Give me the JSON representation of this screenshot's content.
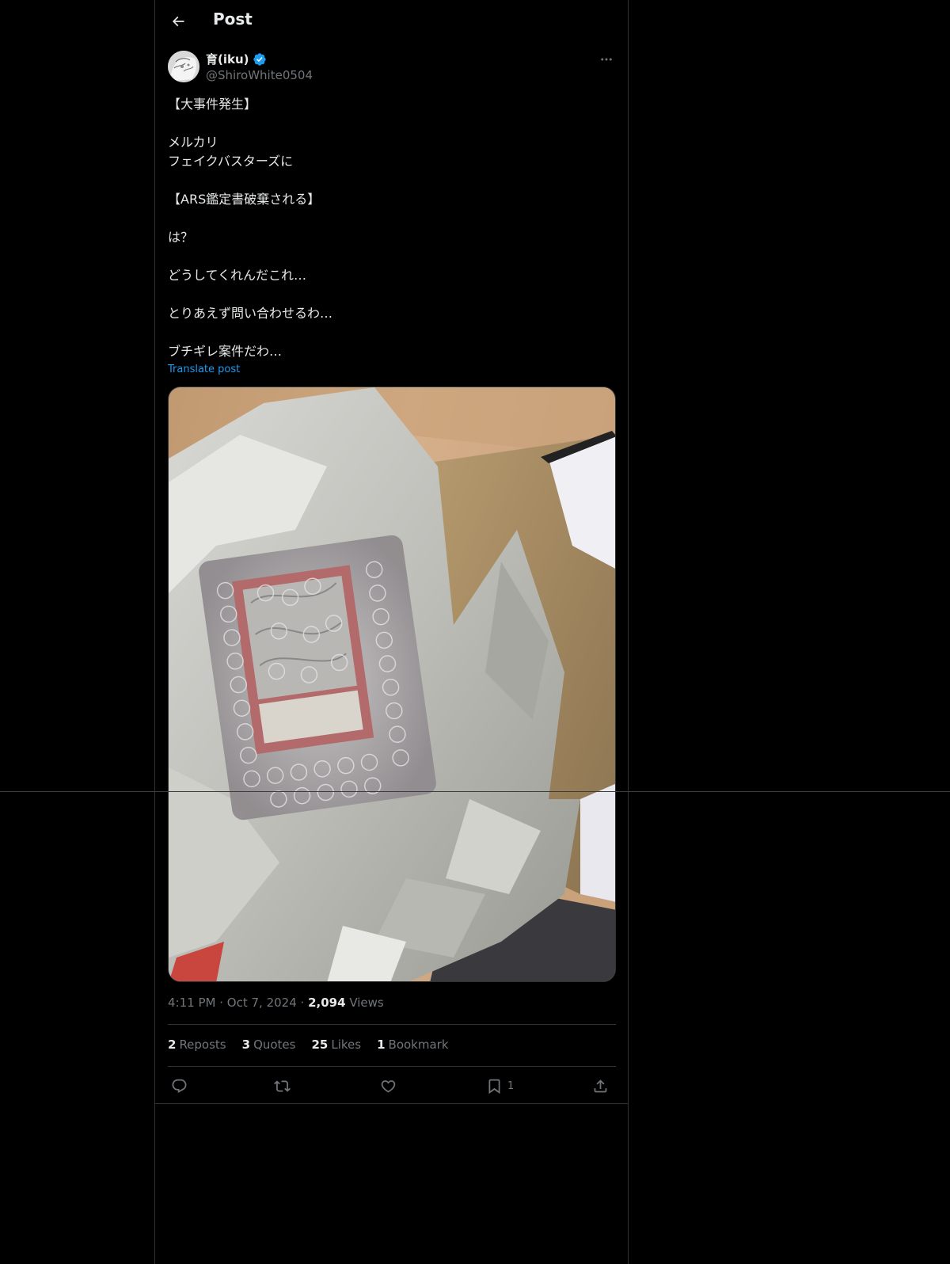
{
  "header": {
    "title": "Post",
    "back_icon": "arrow-left-icon"
  },
  "author": {
    "display_name": "育(iku)",
    "handle": "@ShiroWhite0504",
    "verified": true,
    "verified_color": "#1d9bf0"
  },
  "post": {
    "lines": [
      "【大事件発生】",
      "",
      "メルカリ",
      "フェイクバスターズに",
      "",
      "【ARS鑑定書破棄される】",
      "",
      "は？",
      "",
      "どうしてくれんだこれ…",
      "",
      "とりあえず問い合わせるわ…",
      "",
      "ブチギレ案件だわ…"
    ],
    "translate_label": "Translate post"
  },
  "meta": {
    "time": "4:11 PM",
    "date": "Oct 7, 2024",
    "views_count": "2,094",
    "views_label": "Views"
  },
  "stats": {
    "reposts_count": "2",
    "reposts_label": "Reposts",
    "quotes_count": "3",
    "quotes_label": "Quotes",
    "likes_count": "25",
    "likes_label": "Likes",
    "bookmarks_count": "1",
    "bookmarks_label": "Bookmark"
  },
  "actions": {
    "bookmark_count": "1"
  },
  "colors": {
    "background": "#000000",
    "text": "#e7e9ea",
    "secondary": "#71767b",
    "accent": "#1d9bf0",
    "border": "#2f3336"
  }
}
